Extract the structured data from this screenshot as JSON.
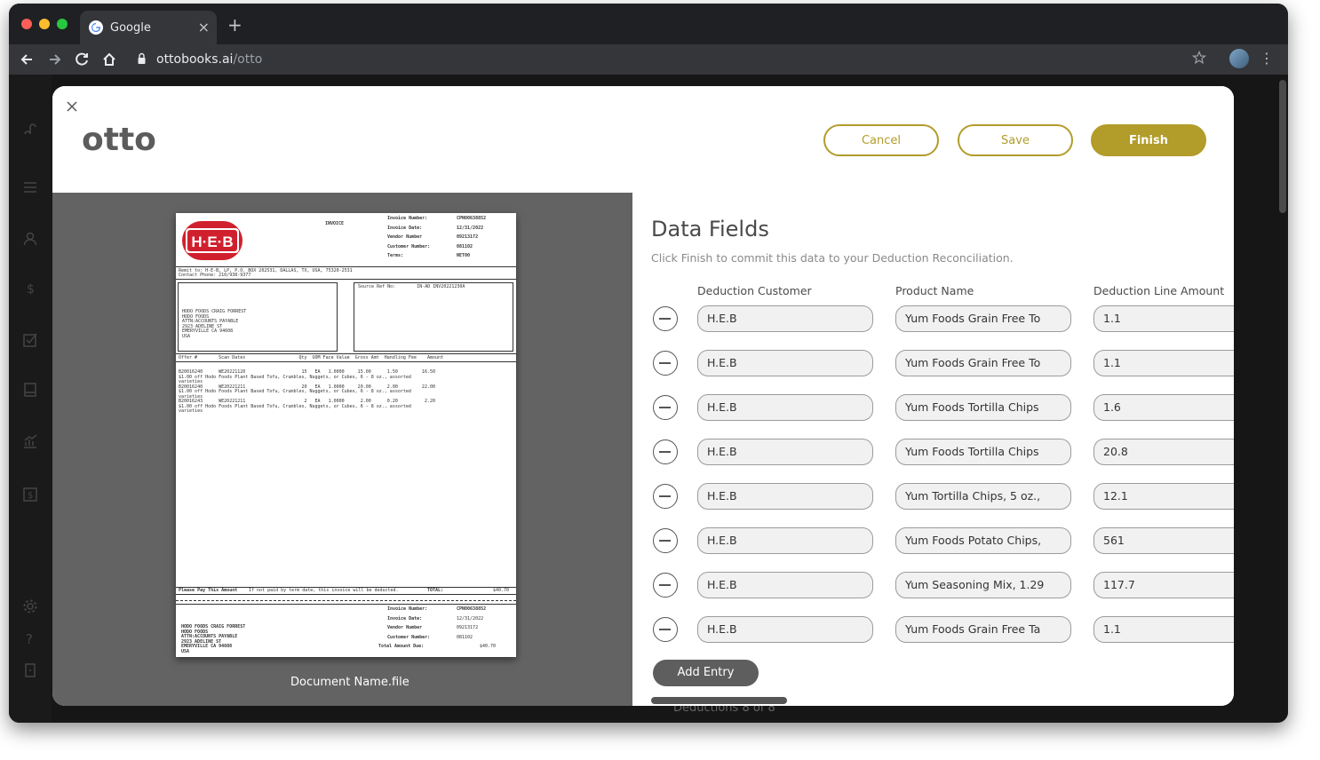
{
  "browser": {
    "tab_title": "Google",
    "url_host": "ottobooks.ai",
    "url_path": "/otto"
  },
  "app": {
    "footer_text": "Deductions 8 of 8"
  },
  "modal": {
    "brand": "otto",
    "cancel_label": "Cancel",
    "save_label": "Save",
    "finish_label": "Finish"
  },
  "document": {
    "name": "Document Name.file",
    "logo_text": "H·E·B",
    "header": {
      "title": "INVOICE",
      "rows": [
        {
          "label": "Invoice Number:",
          "value": "CPN00638852"
        },
        {
          "label": "Invoice Date:",
          "value": "12/31/2022"
        },
        {
          "label": "Vendor Number",
          "value": "09213172"
        },
        {
          "label": "Customer Number:",
          "value": "081102"
        },
        {
          "label": "Terms:",
          "value": "NET00"
        }
      ]
    },
    "remit_line1": "Remit to: H-E-B, LP, P.O. BOX 202531, DALLAS, TX, USA, 75320-2531",
    "remit_line2": "Contact Phone: 210/938-9377",
    "address": "HODO FOODS CRAIG FORREST\nHODO FOODS\nATTN:ACCOUNTS PAYABLE\n2923 ADELINE ST\nEMERYVILLE CA 94608\nUSA",
    "source_ref": "Source Ref No:        IN-AD INV20221230A",
    "table_header": "Offer #        Scan Dates                    Qty  UOM Face Value  Gross Amt  Handling Fee    Amount",
    "table_rows": "B20016240      WE20221120                     15   EA   1.0000     15.00      1.50         16.50\n$1.00 off Hodo Foods Plant Based Tofu, Crumbles, Nuggets, or Cubes, 6 - 8 oz., assorted\nvarieties\nB20016240      WE20221211                     20   EA   1.0000     20.00      2.00         22.00\n$1.00 off Hodo Foods Plant Based Tofu, Crumbles, Nuggets, or Cubes, 6 - 8 oz., assorted\nvarieties\nB20016243      WE20221211                      2   EA   1.0000      2.00      0.20          2.20\n$1.00 off Hodo Foods Plant Based Tofu, Crumbles, Nuggets, or Cubes, 6 - 8 oz., assorted\nvarieties",
    "pay_line": "Please Pay This Amount",
    "pay_note": "If not paid by term date, this invoice will be deducted.",
    "total_label": "TOTAL:",
    "total_value": "$40.70",
    "stub_rows": [
      {
        "label": "Invoice Number:",
        "value": "CPN00638852"
      },
      {
        "label": "Invoice Date:",
        "value": "12/31/2022"
      },
      {
        "label": "Vendor Number",
        "value": "09213172"
      },
      {
        "label": "Customer Number:",
        "value": "081102"
      },
      {
        "label": "Total Amount Due:",
        "value": "$40.70"
      }
    ]
  },
  "fields": {
    "title": "Data Fields",
    "subtitle": "Click Finish to commit this data to your Deduction Reconciliation.",
    "columns": [
      "Deduction Customer",
      "Product Name",
      "Deduction Line Amount"
    ],
    "rows": [
      {
        "customer": "H.E.B",
        "product": "Yum Foods Grain Free To",
        "amount": "1.1"
      },
      {
        "customer": "H.E.B",
        "product": "Yum Foods Grain Free To",
        "amount": "1.1"
      },
      {
        "customer": "H.E.B",
        "product": "Yum Foods Tortilla Chips",
        "amount": "1.6"
      },
      {
        "customer": "H.E.B",
        "product": "Yum Foods Tortilla Chips",
        "amount": "20.8"
      },
      {
        "customer": "H.E.B",
        "product": "Yum Tortilla Chips, 5 oz.,",
        "amount": "12.1"
      },
      {
        "customer": "H.E.B",
        "product": "Yum Foods Potato Chips,",
        "amount": "561"
      },
      {
        "customer": "H.E.B",
        "product": "Yum Seasoning Mix, 1.29",
        "amount": "117.7"
      },
      {
        "customer": "H.E.B",
        "product": "Yum Foods Grain Free Ta",
        "amount": "1.1"
      }
    ],
    "add_entry_label": "Add Entry"
  }
}
